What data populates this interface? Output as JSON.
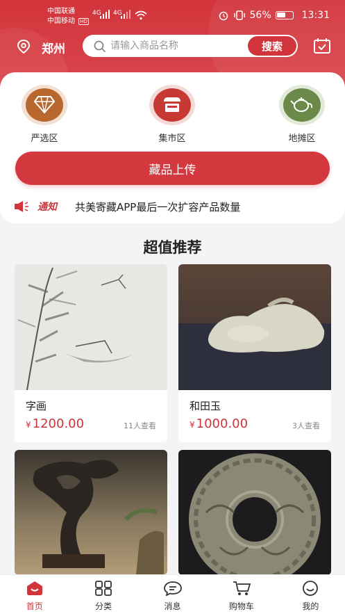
{
  "status": {
    "carrier1": "中国联通",
    "carrier2": "中国移动",
    "hd": "HD",
    "net1": "4G",
    "net2": "4G",
    "battery": "56%",
    "time": "13:31"
  },
  "header": {
    "city": "郑州",
    "search_placeholder": "请输入商品名称",
    "search_button": "搜索"
  },
  "zones": [
    {
      "label": "严选区",
      "icon": "diamond-icon"
    },
    {
      "label": "集市区",
      "icon": "shop-icon"
    },
    {
      "label": "地摊区",
      "icon": "teapot-icon"
    }
  ],
  "upload_button": "藏品上传",
  "notice": {
    "tag": "通知",
    "text": "共美寄藏APP最后一次扩容产品数量"
  },
  "recommend_title": "超值推荐",
  "products": [
    {
      "name": "字画",
      "currency": "¥",
      "price": "1200.00",
      "views": "11人查看"
    },
    {
      "name": "和田玉",
      "currency": "¥",
      "price": "1000.00",
      "views": "3人查看"
    },
    {
      "name": "",
      "currency": "",
      "price": "",
      "views": ""
    },
    {
      "name": "",
      "currency": "",
      "price": "",
      "views": ""
    }
  ],
  "tabs": [
    {
      "label": "首页",
      "icon": "home-icon",
      "active": true
    },
    {
      "label": "分类",
      "icon": "category-icon"
    },
    {
      "label": "消息",
      "icon": "message-icon"
    },
    {
      "label": "购物车",
      "icon": "cart-icon"
    },
    {
      "label": "我的",
      "icon": "profile-icon"
    }
  ],
  "colors": {
    "accent": "#d2343b",
    "price": "#cc333a"
  }
}
